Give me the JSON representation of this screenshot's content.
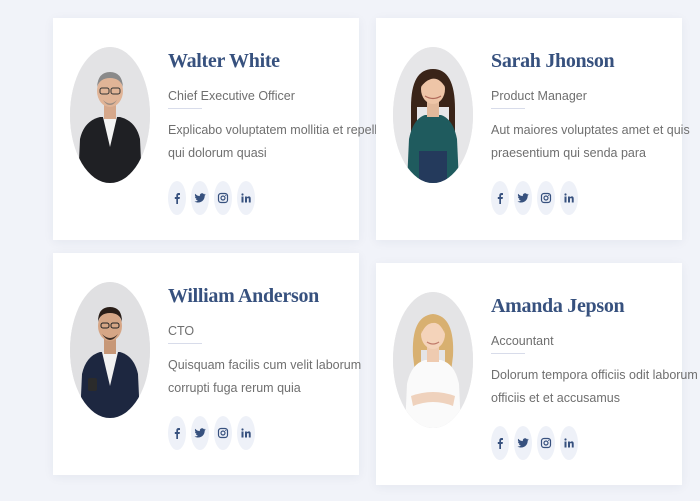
{
  "team": [
    {
      "name": "Walter White",
      "role": "Chief Executive Officer",
      "bio": [
        "Explicabo voluptatem mollitia et repellat",
        "qui dolorum quasi"
      ],
      "portrait": "man-in-dark-suit"
    },
    {
      "name": "Sarah Jhonson",
      "role": "Product Manager",
      "bio": [
        "Aut maiores voluptates amet et quis",
        "praesentium qui senda para"
      ],
      "portrait": "woman-in-teal-top"
    },
    {
      "name": "William Anderson",
      "role": "CTO",
      "bio": [
        "Quisquam facilis cum velit laborum",
        "corrupti fuga rerum quia"
      ],
      "portrait": "man-in-navy-blazer"
    },
    {
      "name": "Amanda Jepson",
      "role": "Accountant",
      "bio": [
        "Dolorum tempora officiis odit laborum",
        "officiis et et accusamus"
      ],
      "portrait": "woman-in-white-blouse"
    }
  ],
  "social_icons": [
    "facebook-icon",
    "twitter-icon",
    "instagram-icon",
    "linkedin-icon"
  ],
  "colors": {
    "page_bg": "#f1f3f9",
    "card_bg": "#ffffff",
    "name": "#37517e",
    "text": "#6f6f6f",
    "icon_bg": "#eef1f8"
  }
}
